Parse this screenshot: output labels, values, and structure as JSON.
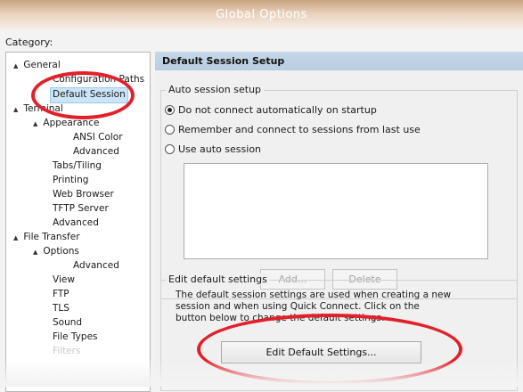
{
  "window": {
    "title": "Global Options"
  },
  "category_label": "Category:",
  "tree": [
    {
      "label": "General",
      "expander": "▲"
    },
    {
      "label": "Configuration Paths"
    },
    {
      "label": "Default Session",
      "selected": true
    },
    {
      "label": "Terminal",
      "expander": "▲"
    },
    {
      "label": "Appearance",
      "expander": "▲"
    },
    {
      "label": "ANSI Color"
    },
    {
      "label": "Advanced"
    },
    {
      "label": "Tabs/Tiling"
    },
    {
      "label": "Printing"
    },
    {
      "label": "Web Browser"
    },
    {
      "label": "TFTP Server"
    },
    {
      "label": "Advanced"
    },
    {
      "label": "File Transfer",
      "expander": "▲"
    },
    {
      "label": "Options",
      "expander": "▲"
    },
    {
      "label": "Advanced"
    },
    {
      "label": "View"
    },
    {
      "label": "FTP"
    },
    {
      "label": "TLS"
    },
    {
      "label": "Sound"
    },
    {
      "label": "File Types"
    },
    {
      "label": "Filters"
    }
  ],
  "panel": {
    "header": "Default Session Setup",
    "auto_session": {
      "title": "Auto session setup",
      "options": [
        {
          "label": "Do not connect automatically on startup",
          "checked": true
        },
        {
          "label": "Remember and connect to sessions from last use",
          "checked": false
        },
        {
          "label": "Use auto session",
          "checked": false
        }
      ],
      "add_button": "Add...",
      "delete_button": "Delete"
    },
    "edit_defaults": {
      "title": "Edit default settings",
      "description_lines": [
        "The default session settings are used when creating a new",
        "session and when using Quick Connect.  Click on the",
        "button below to change the default settings."
      ],
      "button": "Edit Default Settings..."
    }
  },
  "colors": {
    "annotation": "#e3202a",
    "header": "#b8cde0",
    "selection": "#cce4f7"
  }
}
